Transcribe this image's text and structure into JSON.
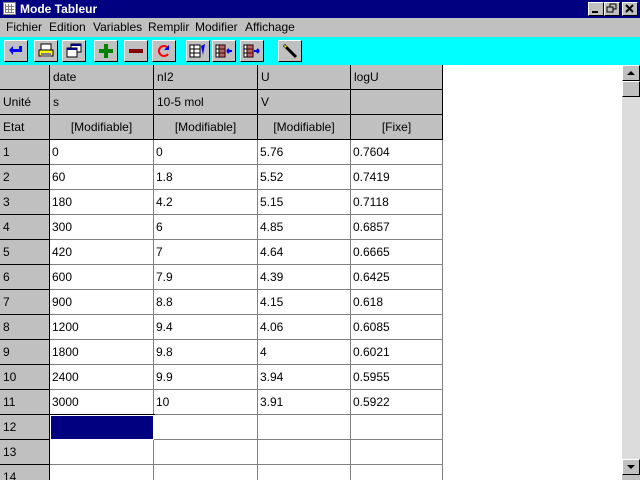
{
  "window": {
    "title": "Mode Tableur"
  },
  "menu": [
    "Fichier",
    "Edition",
    "Variables",
    "Remplir",
    "Modifier",
    "Affichage"
  ],
  "toolbar": {
    "buttons": [
      "back-arrow-icon",
      "print-icon",
      "windows-icon",
      "plus-icon",
      "minus-icon",
      "refresh-icon",
      "table-edit-icon",
      "table-import-icon",
      "table-export-icon",
      "pen-icon"
    ],
    "background_color": "#00ffff"
  },
  "table": {
    "row_header_labels": [
      "",
      "Unité",
      "Etat"
    ],
    "columns": [
      {
        "name": "date",
        "unit": "s",
        "state": "[Modifiable]"
      },
      {
        "name": "nI2",
        "unit": "10-5 mol",
        "state": "[Modifiable]"
      },
      {
        "name": "U",
        "unit": "V",
        "state": "[Modifiable]"
      },
      {
        "name": "logU",
        "unit": "",
        "state": "[Fixe]"
      }
    ],
    "row_numbers": [
      "1",
      "2",
      "3",
      "4",
      "5",
      "6",
      "7",
      "8",
      "9",
      "10",
      "11",
      "12",
      "13",
      "14"
    ],
    "rows": [
      [
        "0",
        "0",
        "5.76",
        "0.7604"
      ],
      [
        "60",
        "1.8",
        "5.52",
        "0.7419"
      ],
      [
        "180",
        "4.2",
        "5.15",
        "0.7118"
      ],
      [
        "300",
        "6",
        "4.85",
        "0.6857"
      ],
      [
        "420",
        "7",
        "4.64",
        "0.6665"
      ],
      [
        "600",
        "7.9",
        "4.39",
        "0.6425"
      ],
      [
        "900",
        "8.8",
        "4.15",
        "0.618"
      ],
      [
        "1200",
        "9.4",
        "4.06",
        "0.6085"
      ],
      [
        "1800",
        "9.8",
        "4",
        "0.6021"
      ],
      [
        "2400",
        "9.9",
        "3.94",
        "0.5955"
      ],
      [
        "3000",
        "10",
        "3.91",
        "0.5922"
      ],
      [
        "",
        "",
        "",
        ""
      ],
      [
        "",
        "",
        "",
        ""
      ],
      [
        "",
        "",
        "",
        ""
      ]
    ],
    "selected_cell": "row 12, date",
    "selection_color": "#000080"
  }
}
